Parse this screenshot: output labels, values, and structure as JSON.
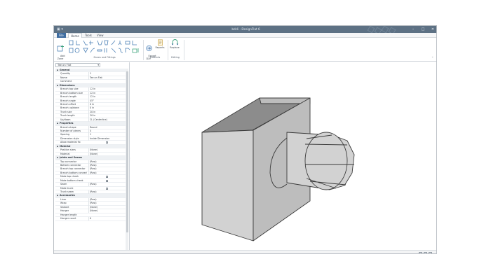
{
  "window": {
    "title": "bdcli - DesignFlat 6",
    "qat": "▣ ▾",
    "minimize": "–",
    "maximize": "□",
    "close": "✕"
  },
  "menu": {
    "tabs": [
      "File",
      "Home",
      "Tools",
      "View"
    ],
    "active": "Home"
  },
  "ribbon": {
    "add_zone": "Add\nZone",
    "group_zones": "Zones and Fittings",
    "export_dxf": "Export\nDXF",
    "reports": "Reports",
    "group_products": "Products",
    "replace": "Replace",
    "group_editing": "Editing",
    "accent": "#3f6da1",
    "fitting_color": "#4a7fb5",
    "fitting_alt_color": "#3aa37a"
  },
  "panel": {
    "selector": "Tee on Flat",
    "rows": [
      {
        "kind": "cat",
        "label": "General"
      },
      {
        "kind": "prop",
        "label": "Quantity",
        "value": "1"
      },
      {
        "kind": "prop",
        "label": "Name",
        "value": "Tee on Flat"
      },
      {
        "kind": "prop",
        "label": "Comment",
        "value": ""
      },
      {
        "kind": "cat",
        "label": "Dimensions"
      },
      {
        "kind": "prop",
        "label": "Branch top size",
        "value": "12 in"
      },
      {
        "kind": "prop",
        "label": "Branch bottom size",
        "value": "12 in"
      },
      {
        "kind": "prop",
        "label": "Branch length",
        "value": "12 in"
      },
      {
        "kind": "prop",
        "label": "Branch angle",
        "value": "45°"
      },
      {
        "kind": "prop",
        "label": "Branch offset",
        "value": "0 in"
      },
      {
        "kind": "prop",
        "label": "Branch up/down",
        "value": "0 in"
      },
      {
        "kind": "prop",
        "label": "Trunk size",
        "value": "20 in"
      },
      {
        "kind": "prop",
        "label": "Trunk length",
        "value": "20 in"
      },
      {
        "kind": "prop",
        "label": "Up/down",
        "value": "CL (Centerline)"
      },
      {
        "kind": "cat",
        "label": "Properties"
      },
      {
        "kind": "prop",
        "label": "Branch shape",
        "value": "Round"
      },
      {
        "kind": "prop",
        "label": "Number of pieces",
        "value": "4"
      },
      {
        "kind": "prop",
        "label": "Spacing",
        "value": "1"
      },
      {
        "kind": "prop",
        "label": "Dimension style",
        "value": "Inside Dimension"
      },
      {
        "kind": "prop",
        "label": "Allow material fix",
        "value": "",
        "check": "✓"
      },
      {
        "kind": "cat",
        "label": "Material"
      },
      {
        "kind": "prop",
        "label": "Position sizes",
        "value": "(None)"
      },
      {
        "kind": "prop",
        "label": "Material",
        "value": "(None)"
      },
      {
        "kind": "cat",
        "label": "Joints and Seams"
      },
      {
        "kind": "prop",
        "label": "Top connector",
        "value": "(Raw)"
      },
      {
        "kind": "prop",
        "label": "Bottom connector",
        "value": "(Raw)"
      },
      {
        "kind": "prop",
        "label": "Branch top connector",
        "value": "(Raw)"
      },
      {
        "kind": "prop",
        "label": "Branch bottom connector",
        "value": "(Raw)"
      },
      {
        "kind": "prop",
        "label": "Make top cheek",
        "value": "",
        "check": "✓"
      },
      {
        "kind": "prop",
        "label": "Make bottom cheek",
        "value": "",
        "check": "✓"
      },
      {
        "kind": "prop",
        "label": "Seam",
        "value": "(Raw)"
      },
      {
        "kind": "prop",
        "label": "Make trunk",
        "value": "",
        "check": "✓"
      },
      {
        "kind": "prop",
        "label": "Trunk seam",
        "value": "(Raw)"
      },
      {
        "kind": "cat",
        "label": "Accessories"
      },
      {
        "kind": "prop",
        "label": "Liner",
        "value": "(Raw)"
      },
      {
        "kind": "prop",
        "label": "Wrap",
        "value": "(Raw)"
      },
      {
        "kind": "prop",
        "label": "Sealant",
        "value": "(None)"
      },
      {
        "kind": "prop",
        "label": "Hanger",
        "value": "(None)"
      },
      {
        "kind": "prop",
        "label": "Hanger length",
        "value": ""
      },
      {
        "kind": "prop",
        "label": "Hanger count",
        "value": "0"
      }
    ]
  },
  "viewport": {
    "swatch_primary": "#000000",
    "swatch_secondary": "#ffffff",
    "swatch_tertiary": "#9ea5ad",
    "model_light": "#d2d2d2",
    "model_mid": "#bdbdbd",
    "model_dark": "#8c8c8c",
    "model_edge": "#3a3a3a"
  },
  "status": {
    "view_hint": "···"
  }
}
